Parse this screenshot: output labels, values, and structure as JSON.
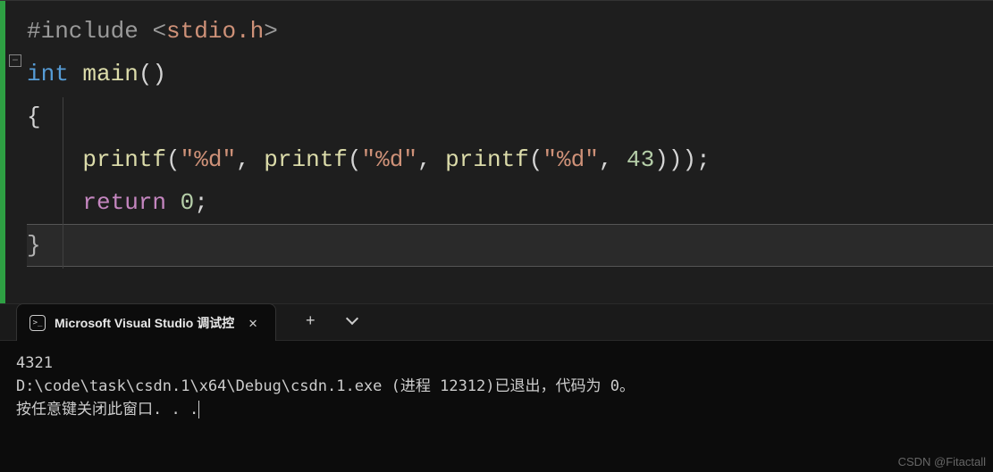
{
  "code": {
    "line1": {
      "include": "#include ",
      "angle1": "<",
      "header": "stdio.h",
      "angle2": ">"
    },
    "line2": {
      "type": "int",
      "space": " ",
      "func": "main",
      "parens": "()"
    },
    "line3": "{",
    "line4": {
      "indent": "    ",
      "fn": "printf",
      "p1": "(",
      "str1": "\"%d\"",
      "c1": ", ",
      "fn2": "printf",
      "p2": "(",
      "str2": "\"%d\"",
      "c2": ", ",
      "fn3": "printf",
      "p3": "(",
      "str3": "\"%d\"",
      "c3": ", ",
      "num": "43",
      "close": ")));"
    },
    "line5": {
      "indent": "    ",
      "ret": "return",
      "space": " ",
      "val": "0",
      "semi": ";"
    },
    "line6": "}"
  },
  "terminal": {
    "tab_title": "Microsoft Visual Studio 调试控",
    "output_line1": "4321",
    "output_line2": "D:\\code\\task\\csdn.1\\x64\\Debug\\csdn.1.exe (进程 12312)已退出，代码为 0。",
    "output_line3": "按任意键关闭此窗口. . ."
  },
  "watermark": "CSDN @Fitactall"
}
